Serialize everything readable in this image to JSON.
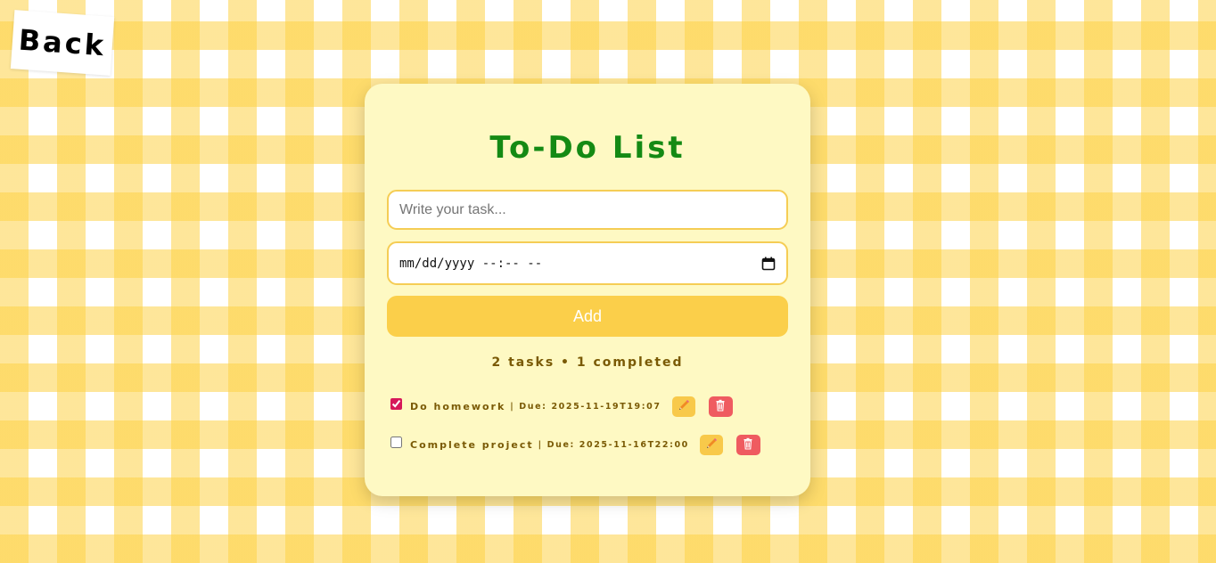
{
  "back": {
    "label": "Back"
  },
  "app": {
    "title": "To-Do List"
  },
  "form": {
    "task_placeholder": "Write your task...",
    "task_value": "",
    "date_display": "mm/dd/yyyy --:-- --",
    "add_label": "Add"
  },
  "stats": {
    "text": "2 tasks • 1 completed"
  },
  "tasks": [
    {
      "name": "Do homework",
      "due": "| Due: 2025-11-19T19:07",
      "completed": true
    },
    {
      "name": "Complete project",
      "due": "| Due: 2025-11-16T22:00",
      "completed": false
    }
  ],
  "icons": {
    "calendar": "calendar-icon",
    "edit": "pencil-icon",
    "delete": "trash-icon"
  },
  "colors": {
    "title": "#148a14",
    "card": "#fef9c3",
    "accent": "#fbcf4a",
    "input_border": "#f5cd55",
    "delete": "#ef5b60",
    "task_text": "#7a5a05",
    "checkbox": "#d6185a"
  }
}
